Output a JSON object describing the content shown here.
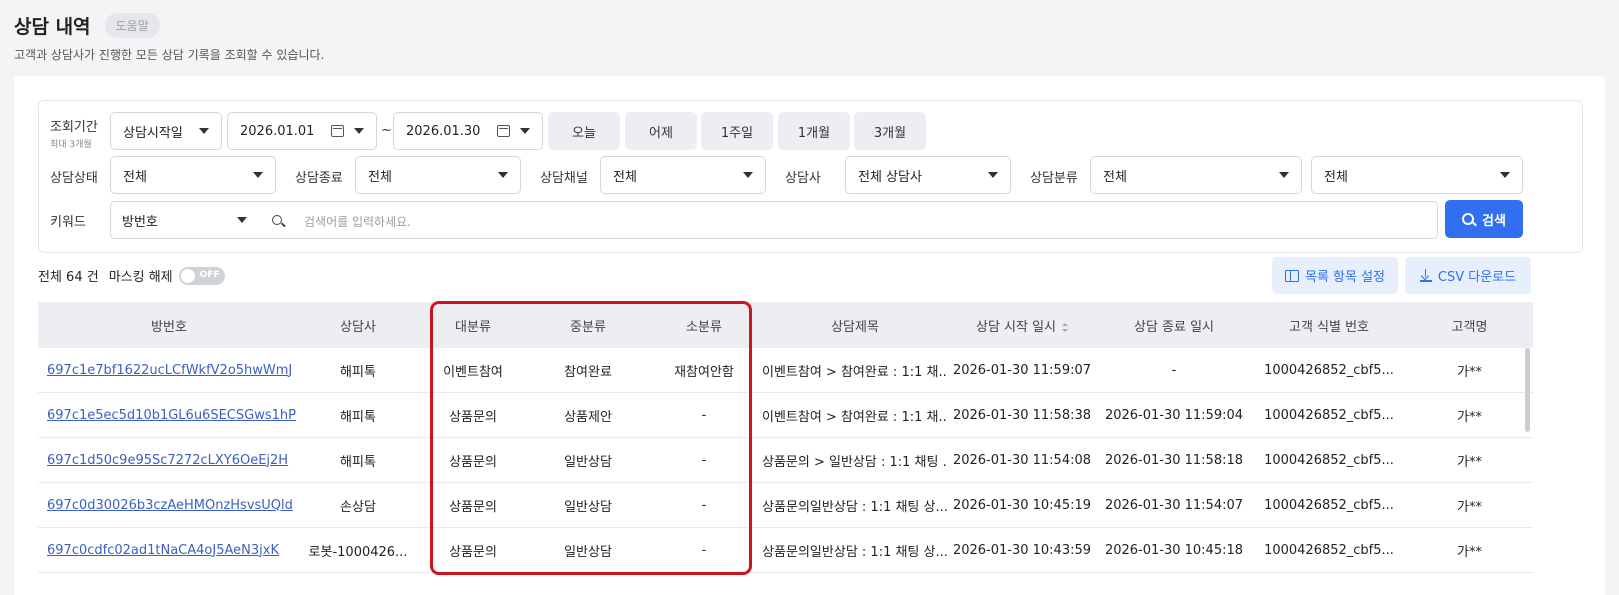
{
  "header": {
    "title": "상담 내역",
    "help_label": "도움말",
    "subtitle": "고객과 상담사가 진행한 모든 상담 기록을 조회할 수 있습니다."
  },
  "filters": {
    "period": {
      "label": "조회기간",
      "hint": "최대 3개월",
      "type_value": "상담시작일",
      "start_date": "2026.01.01",
      "separator": "~",
      "end_date": "2026.01.30"
    },
    "quick": [
      "오늘",
      "어제",
      "1주일",
      "1개월",
      "3개월"
    ],
    "status": {
      "label": "상담상태",
      "value": "전체"
    },
    "end_type": {
      "label": "상담종료",
      "value": "전체"
    },
    "channel": {
      "label": "상담채널",
      "value": "전체"
    },
    "agent": {
      "label": "상담사",
      "value": "전체 상담사"
    },
    "category": {
      "label": "상담분류",
      "value": "전체",
      "value2": "전체"
    },
    "keyword": {
      "label": "키워드",
      "field": "방번호",
      "placeholder": "검색어를 입력하세요."
    },
    "search_label": "검색"
  },
  "meta": {
    "count_label": "전체 64 건",
    "masking_label": "마스킹 해제",
    "masking_state": "OFF"
  },
  "tools": {
    "columns_label": "목록 항목 설정",
    "csv_label": "CSV 다운로드"
  },
  "table": {
    "columns": [
      "방번호",
      "상담사",
      "대분류",
      "중분류",
      "소분류",
      "상담제목",
      "상담 시작 일시",
      "상담 종료 일시",
      "고객 식별 번호",
      "고객명"
    ],
    "rows": [
      [
        "697c1e7bf1622ucLCfWkfV2o5hwWmJ",
        "해피톡",
        "이벤트참여",
        "참여완료",
        "재참여안함",
        "이벤트참여 > 참여완료 : 1:1 채...",
        "2026-01-30 11:59:07",
        "-",
        "1000426852_cbf5...",
        "가**"
      ],
      [
        "697c1e5ec5d10b1GL6u6SECSGws1hP",
        "해피톡",
        "상품문의",
        "상품제안",
        "-",
        "이벤트참여 > 참여완료 : 1:1 채...",
        "2026-01-30 11:58:38",
        "2026-01-30 11:59:04",
        "1000426852_cbf5...",
        "가**"
      ],
      [
        "697c1d50c9e95Sc7272cLXY6OeEj2H",
        "해피톡",
        "상품문의",
        "일반상담",
        "-",
        "상품문의 > 일반상담 : 1:1 채팅 ...",
        "2026-01-30 11:54:08",
        "2026-01-30 11:58:18",
        "1000426852_cbf5...",
        "가**"
      ],
      [
        "697c0d30026b3czAeHMOnzHsvsUQld",
        "손상담",
        "상품문의",
        "일반상담",
        "-",
        "상품문의일반상담 : 1:1 채팅 상...",
        "2026-01-30 10:45:19",
        "2026-01-30 11:54:07",
        "1000426852_cbf5...",
        "가**"
      ],
      [
        "697c0cdfc02ad1tNaCA4oJ5AeN3jxK",
        "로봇-1000426...",
        "상품문의",
        "일반상담",
        "-",
        "상품문의일반상담 : 1:1 채팅 상...",
        "2026-01-30 10:43:59",
        "2026-01-30 10:45:18",
        "1000426852_cbf5...",
        "가**"
      ]
    ]
  },
  "colors": {
    "primary": "#2f6ff0",
    "highlight": "#d0141e",
    "link": "#3b5fc4"
  }
}
